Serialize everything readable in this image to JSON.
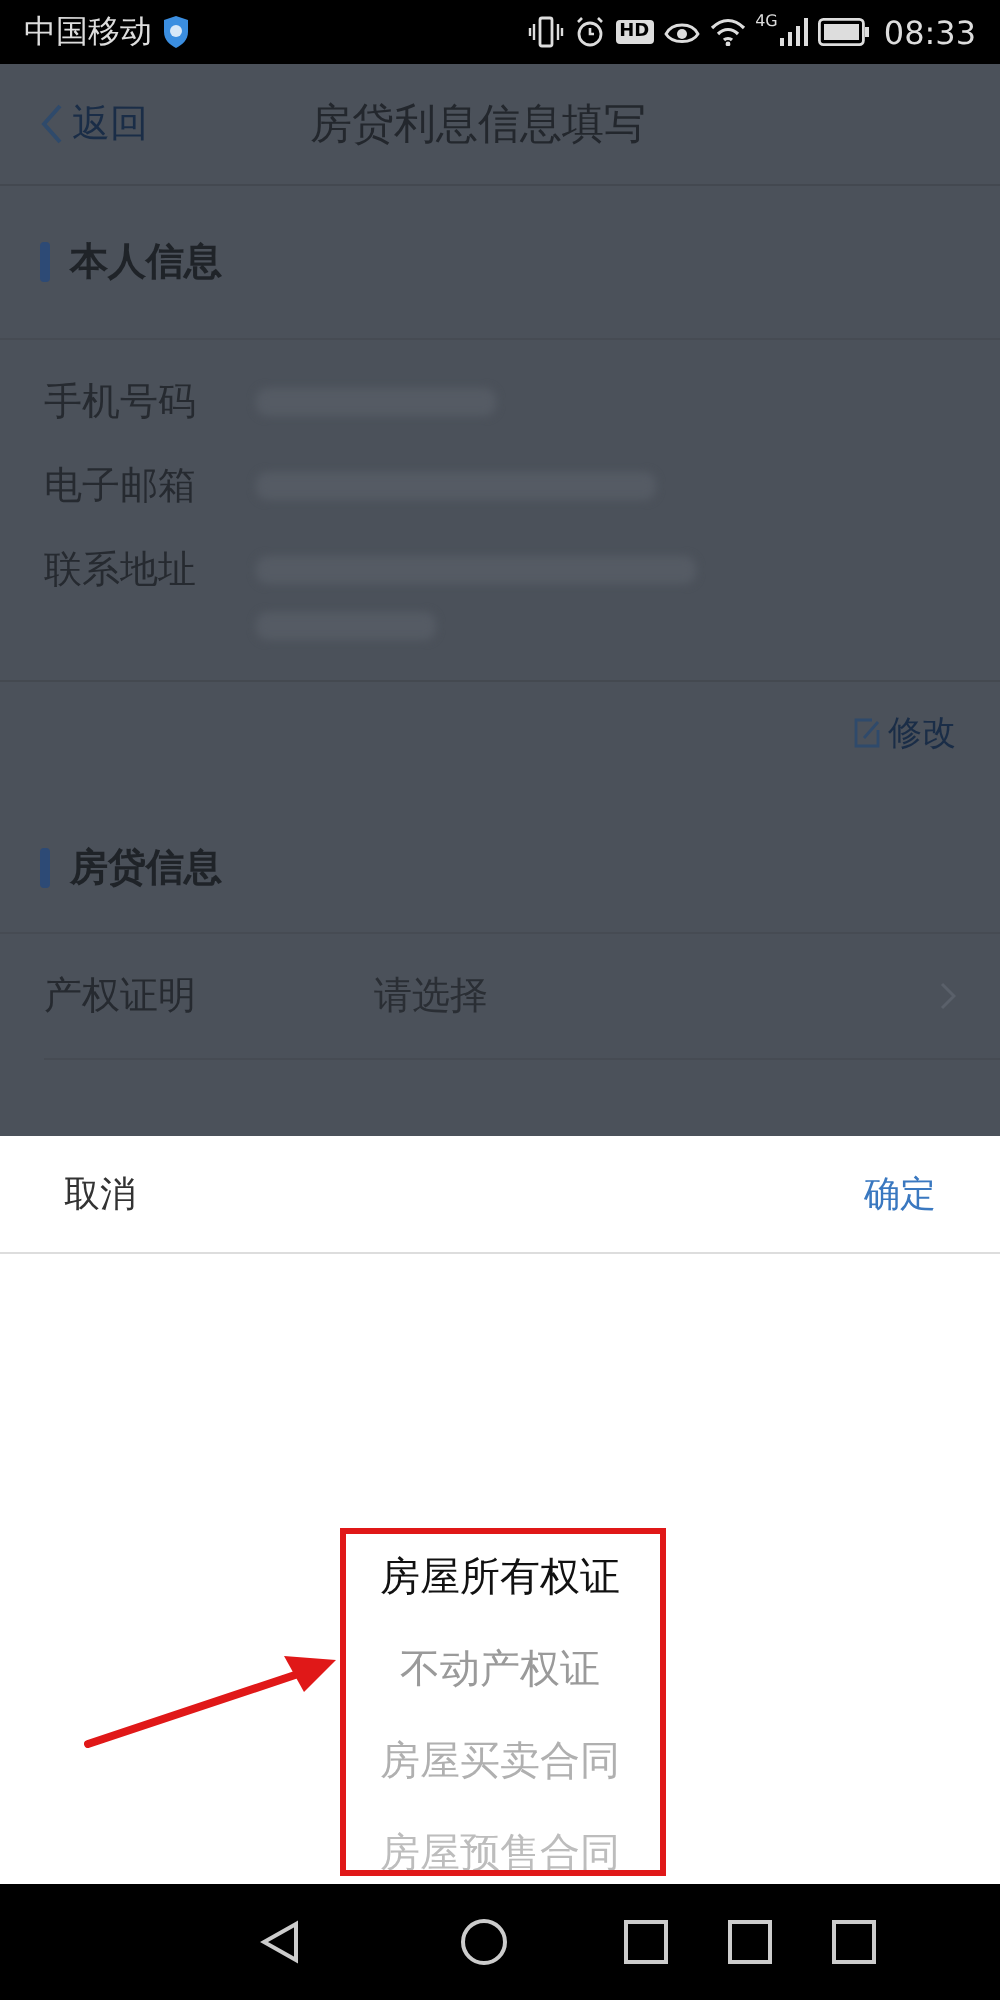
{
  "status_bar": {
    "carrier": "中国移动",
    "hd_label": "HD",
    "network_label": "4G",
    "time": "08:33"
  },
  "nav": {
    "back": "返回",
    "title": "房贷利息信息填写"
  },
  "personal": {
    "heading": "本人信息",
    "fields": [
      {
        "label": "手机号码",
        "kind": "short"
      },
      {
        "label": "电子邮箱",
        "kind": "long"
      },
      {
        "label": "联系地址",
        "kind": "address"
      }
    ],
    "edit": "修改"
  },
  "loan": {
    "heading": "房贷信息",
    "fields": [
      {
        "label": "产权证明",
        "placeholder": "请选择"
      }
    ]
  },
  "sheet": {
    "cancel": "取消",
    "confirm": "确定",
    "options": [
      {
        "label": "房屋所有权证",
        "selected": true
      },
      {
        "label": "不动产权证",
        "selected": false
      },
      {
        "label": "房屋买卖合同",
        "selected": false
      },
      {
        "label": "房屋预售合同",
        "selected": false
      }
    ]
  }
}
